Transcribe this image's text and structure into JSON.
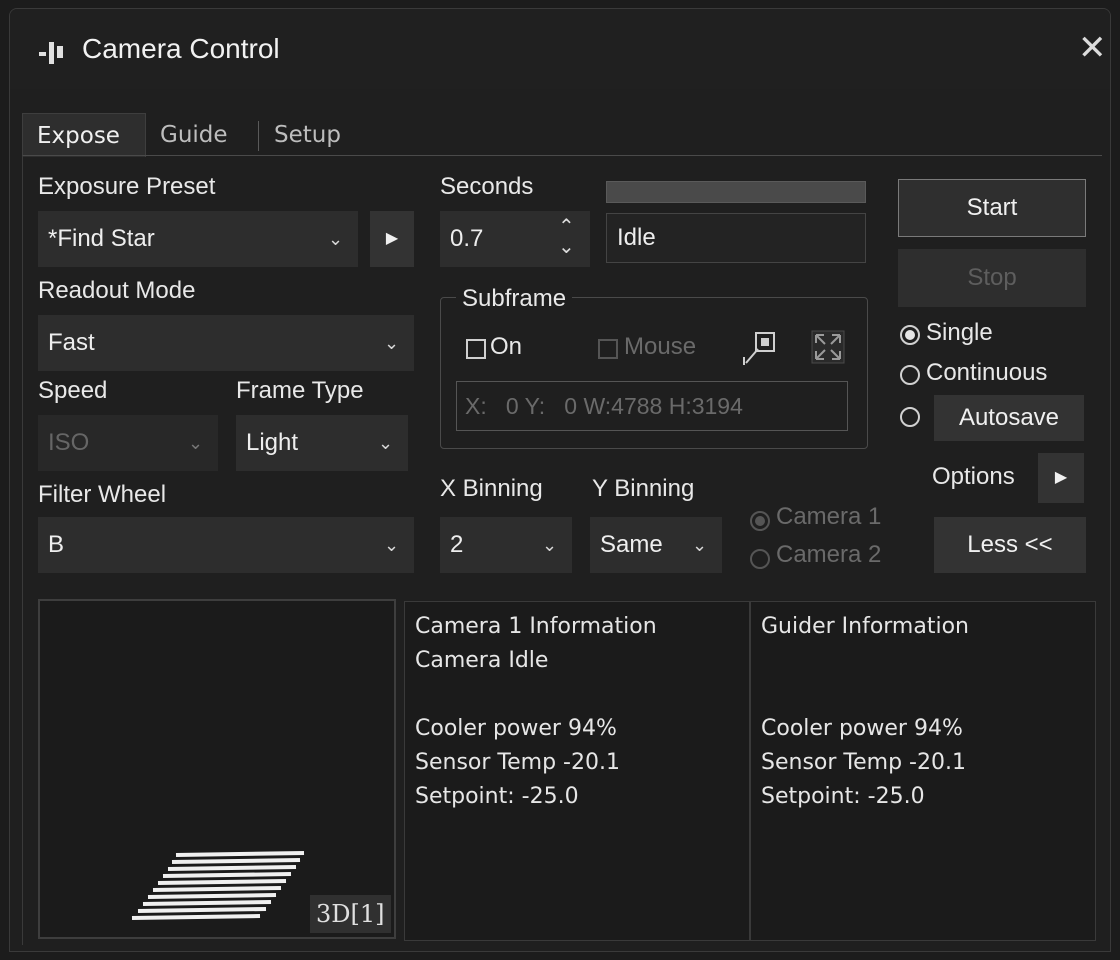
{
  "window": {
    "title": "Camera Control",
    "app_icon": "app-logo-icon",
    "close_icon": "close-icon"
  },
  "tabs": [
    {
      "label": "Expose",
      "active": true
    },
    {
      "label": "Guide",
      "active": false
    },
    {
      "label": "Setup",
      "active": false
    }
  ],
  "exposure": {
    "preset_label": "Exposure Preset",
    "preset_value": "*Find Star",
    "seconds_label": "Seconds",
    "seconds_value": "0.7",
    "status_value": "Idle",
    "progress": 0.0,
    "readout_label": "Readout Mode",
    "readout_value": "Fast",
    "speed_label": "Speed",
    "speed_value": "ISO",
    "frame_type_label": "Frame Type",
    "frame_type_value": "Light",
    "filter_wheel_label": "Filter Wheel",
    "filter_wheel_value": "B",
    "x_binning_label": "X Binning",
    "x_binning_value": "2",
    "y_binning_label": "Y Binning",
    "y_binning_value": "Same"
  },
  "subframe": {
    "legend": "Subframe",
    "on_label": "On",
    "on_checked": false,
    "mouse_label": "Mouse",
    "mouse_checked": false,
    "coords": "X:   0 Y:   0 W:4788 H:3194"
  },
  "controls": {
    "start_label": "Start",
    "stop_label": "Stop",
    "single_label": "Single",
    "continuous_label": "Continuous",
    "autosave_label": "Autosave",
    "options_label": "Options",
    "less_label": "Less <<",
    "camera1_label": "Camera 1",
    "camera2_label": "Camera 2",
    "mode_selected": "Single",
    "camera_selected": "Camera 1"
  },
  "preview": {
    "badge": "3D[1]"
  },
  "camera_info": {
    "title": "Camera 1 Information",
    "status": "Camera Idle",
    "cooler": "Cooler power 94%",
    "sensor_temp": "Sensor Temp -20.1",
    "setpoint": "Setpoint: -25.0"
  },
  "guider_info": {
    "title": "Guider Information",
    "cooler": "Cooler power 94%",
    "sensor_temp": "Sensor Temp -20.1",
    "setpoint": "Setpoint: -25.0"
  }
}
